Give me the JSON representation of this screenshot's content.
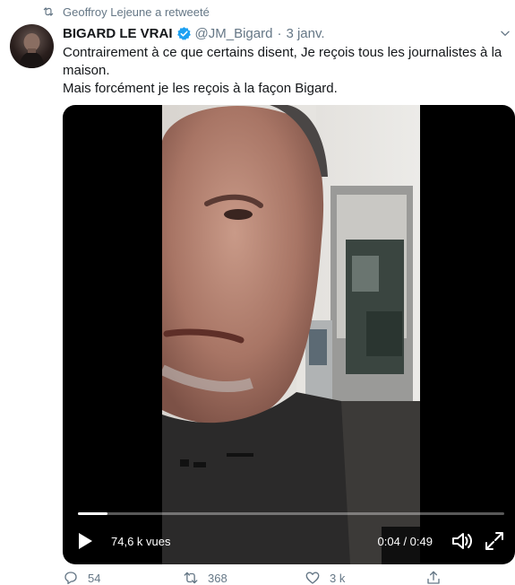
{
  "retweet": {
    "label": "Geoffroy Lejeune a retweeté",
    "icon": "retweet-icon"
  },
  "author": {
    "display_name": "BIGARD LE VRAI",
    "verified": true,
    "handle": "@JM_Bigard",
    "separator": "·",
    "date": "3 janv."
  },
  "tweet": {
    "lines": [
      "Contrairement à ce que certains disent, Je reçois tous les journalistes à la maison.",
      "Mais forcément je les reçois à la façon Bigard."
    ]
  },
  "video": {
    "views": "74,6 k vues",
    "time": "0:04 / 0:49",
    "progress": 0.07,
    "icons": [
      "play-icon",
      "volume-icon",
      "fullscreen-icon"
    ]
  },
  "actions": {
    "replies": "54",
    "retweets": "368",
    "likes": "3 k",
    "share": ""
  },
  "colors": {
    "accent": "#1da1f2",
    "text": "#14171a",
    "secondary": "#657786"
  }
}
